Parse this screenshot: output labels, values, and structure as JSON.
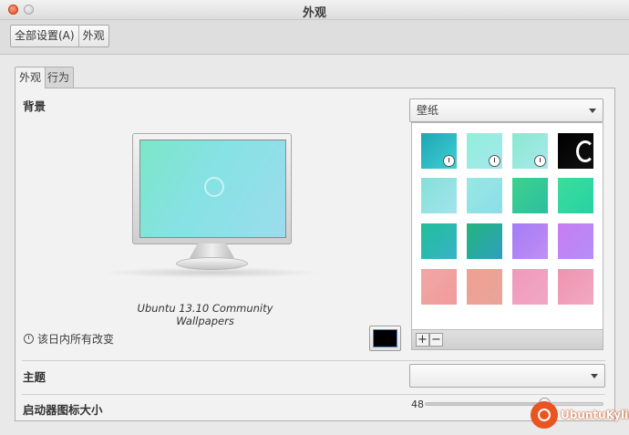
{
  "window": {
    "title": "外观"
  },
  "toolbar": {
    "all_settings": "全部设置(A)",
    "current": "外观"
  },
  "tabs": [
    {
      "label": "外观",
      "active": true
    },
    {
      "label": "行为",
      "active": false
    }
  ],
  "background": {
    "section_label": "背景",
    "wallpaper_name": "Ubuntu 13.10 Community Wallpapers",
    "source_select": {
      "value": "壁纸"
    },
    "change_over_day_label": "该日内所有改变",
    "color_swatch": "#000000",
    "thumbnails": [
      {
        "colors": [
          "#1fa6b4",
          "#3ecfd3"
        ],
        "icon": "clock-icon"
      },
      {
        "colors": [
          "#8ff0d8",
          "#a6e6ef"
        ],
        "icon": "clock-icon"
      },
      {
        "colors": [
          "#8ae9cf",
          "#a9e7ee"
        ],
        "icon": "clock-icon"
      },
      {
        "colors": [
          "#000000",
          "#111111"
        ],
        "icon": "ubuntu-logo-icon"
      },
      {
        "colors": [
          "#84e1d6",
          "#a3e3ee"
        ]
      },
      {
        "colors": [
          "#96e9e2",
          "#8ddde9"
        ]
      },
      {
        "colors": [
          "#3fd18e",
          "#2ac0a0"
        ]
      },
      {
        "colors": [
          "#3ddd9c",
          "#26d2a3"
        ]
      },
      {
        "colors": [
          "#1fbf98",
          "#3ab2c9"
        ]
      },
      {
        "colors": [
          "#22b57c",
          "#2f9fc0"
        ]
      },
      {
        "colors": [
          "#a37cf5",
          "#c18ef5"
        ]
      },
      {
        "colors": [
          "#c77df1",
          "#b58ef8"
        ]
      },
      {
        "colors": [
          "#f0a7a5",
          "#f29a9b"
        ]
      },
      {
        "colors": [
          "#f09f91",
          "#e8a59a"
        ]
      },
      {
        "colors": [
          "#ef9ab8",
          "#f0a8c5"
        ]
      },
      {
        "colors": [
          "#ee93b0",
          "#f2a9c3"
        ]
      }
    ],
    "add_label": "+",
    "remove_label": "−"
  },
  "theme": {
    "label": "主题",
    "value": ""
  },
  "launcher": {
    "label": "启动器图标大小",
    "value": 48,
    "min": 16,
    "max": 64
  },
  "watermark": {
    "text": "UbuntuKylin"
  }
}
